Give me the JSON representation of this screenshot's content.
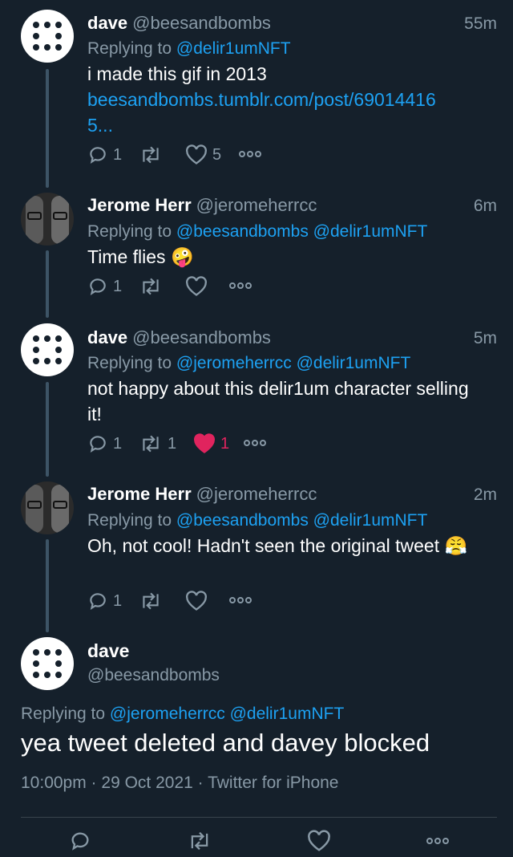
{
  "tweets": [
    {
      "name": "dave",
      "handle": "@beesandbombs",
      "time": "55m",
      "replying_prefix": "Replying to",
      "replying_to": "@delir1umNFT",
      "text": "i made this gif in 2013",
      "link": "beesandbombs.tumblr.com/post/69014416 5...",
      "reply_count": "1",
      "retweet_count": "",
      "like_count": "5"
    },
    {
      "name": "Jerome Herr",
      "handle": "@jeromeherrcc",
      "time": "6m",
      "replying_prefix": "Replying to",
      "replying_to": "@beesandbombs @delir1umNFT",
      "text": "Time flies 🤪",
      "reply_count": "1",
      "retweet_count": "",
      "like_count": ""
    },
    {
      "name": "dave",
      "handle": "@beesandbombs",
      "time": "5m",
      "replying_prefix": "Replying to",
      "replying_to": "@jeromeherrcc @delir1umNFT",
      "text": "not happy about this delir1um character selling it!",
      "reply_count": "1",
      "retweet_count": "1",
      "like_count": "1"
    },
    {
      "name": "Jerome Herr",
      "handle": "@jeromeherrcc",
      "time": "2m",
      "replying_prefix": "Replying to",
      "replying_to": "@beesandbombs @delir1umNFT",
      "text": "Oh, not cool! Hadn't seen the original tweet 😤",
      "reply_count": "1",
      "retweet_count": "",
      "like_count": ""
    }
  ],
  "focused": {
    "name": "dave",
    "handle": "@beesandbombs",
    "replying_prefix": "Replying to",
    "replying_to": "@jeromeherrcc @delir1umNFT",
    "text": "yea tweet deleted and davey blocked",
    "meta": "10:00pm · 29 Oct 2021 · Twitter for iPhone"
  },
  "icons": [
    "reply-icon",
    "retweet-icon",
    "like-icon",
    "more-icon"
  ],
  "colors": {
    "background": "#15202b",
    "link": "#1da1f2",
    "muted": "#8899a6",
    "like": "#e0245e"
  }
}
